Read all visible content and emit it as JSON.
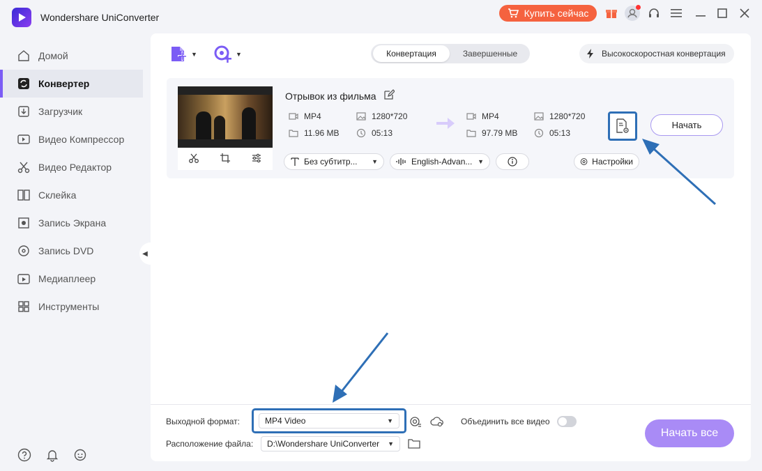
{
  "app": {
    "title": "Wondershare UniConverter",
    "buy_label": "Купить сейчас"
  },
  "sidebar": {
    "items": [
      {
        "label": "Домой",
        "icon": "home-icon"
      },
      {
        "label": "Конвертер",
        "icon": "converter-icon",
        "active": true
      },
      {
        "label": "Загрузчик",
        "icon": "download-icon"
      },
      {
        "label": "Видео Компрессор",
        "icon": "compress-icon"
      },
      {
        "label": "Видео Редактор",
        "icon": "scissors-icon"
      },
      {
        "label": "Склейка",
        "icon": "merge-icon"
      },
      {
        "label": "Запись Экрана",
        "icon": "screen-record-icon"
      },
      {
        "label": "Запись DVD",
        "icon": "dvd-icon"
      },
      {
        "label": "Медиаплеер",
        "icon": "player-icon"
      },
      {
        "label": "Инструменты",
        "icon": "toolbox-icon"
      }
    ]
  },
  "toolbar": {
    "tab_convert": "Конвертация",
    "tab_done": "Завершенные",
    "fast_label": "Высокоскоростная конвертация"
  },
  "file": {
    "title": "Отрывок из фильма",
    "source": {
      "format": "MP4",
      "resolution": "1280*720",
      "size": "11.96 MB",
      "duration": "05:13"
    },
    "output": {
      "format": "MP4",
      "resolution": "1280*720",
      "size": "97.79 MB",
      "duration": "05:13"
    },
    "start_label": "Начать",
    "subtitle_value": "Без субтитр...",
    "audio_value": "English-Advan...",
    "settings_label": "Настройки"
  },
  "bottom": {
    "format_label": "Выходной формат:",
    "format_value": "MP4 Video",
    "location_label": "Расположение файла:",
    "location_value": "D:\\Wondershare UniConverter",
    "merge_label": "Объединить все видео",
    "merge_on": false,
    "start_all_label": "Начать все"
  },
  "colors": {
    "accent": "#7b5cf5",
    "buy": "#f5623f",
    "highlight": "#2e6fb6"
  }
}
